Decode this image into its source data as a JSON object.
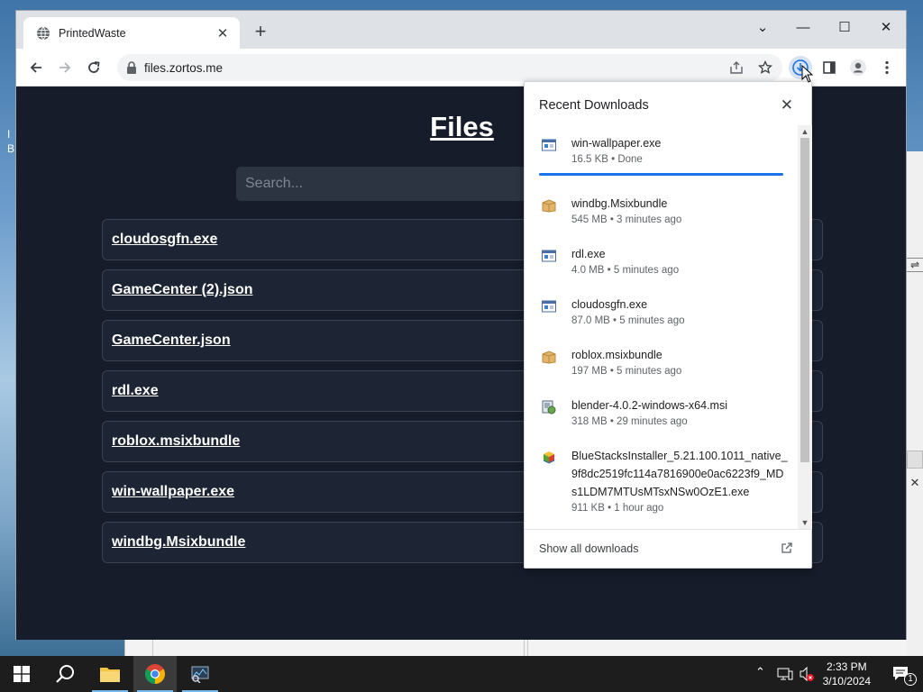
{
  "browser": {
    "tab_title": "PrintedWaste",
    "url": "files.zortos.me"
  },
  "page": {
    "title": "Files",
    "search_placeholder": "Search...",
    "files": [
      "cloudosgfn.exe",
      "GameCenter (2).json",
      "GameCenter.json",
      "rdl.exe",
      "roblox.msixbundle",
      "win-wallpaper.exe",
      "windbg.Msixbundle"
    ]
  },
  "downloads": {
    "header": "Recent Downloads",
    "show_all": "Show all downloads",
    "items": [
      {
        "name": "win-wallpaper.exe",
        "meta": "16.5 KB • Done",
        "icon": "exe-icon"
      },
      {
        "name": "windbg.Msixbundle",
        "meta": "545 MB • 3 minutes ago",
        "icon": "package-icon"
      },
      {
        "name": "rdl.exe",
        "meta": "4.0 MB • 5 minutes ago",
        "icon": "exe-icon"
      },
      {
        "name": "cloudosgfn.exe",
        "meta": "87.0 MB • 5 minutes ago",
        "icon": "exe-icon"
      },
      {
        "name": "roblox.msixbundle",
        "meta": "197 MB • 5 minutes ago",
        "icon": "package-icon"
      },
      {
        "name": "blender-4.0.2-windows-x64.msi",
        "meta": "318 MB • 29 minutes ago",
        "icon": "installer-icon"
      },
      {
        "name": "BlueStacksInstaller_5.21.100.1011_native_9f8dc2519fc114a7816900e0ac6223f9_MDs1LDM7MTUsMTsxNSw0OzE1.exe",
        "meta": "911 KB • 1 hour ago",
        "icon": "bluestacks-icon"
      }
    ]
  },
  "taskbar": {
    "time": "2:33 PM",
    "date": "3/10/2024",
    "notification_count": "1"
  },
  "colors": {
    "page_bg": "#161c29",
    "progress": "#1a73e8"
  }
}
